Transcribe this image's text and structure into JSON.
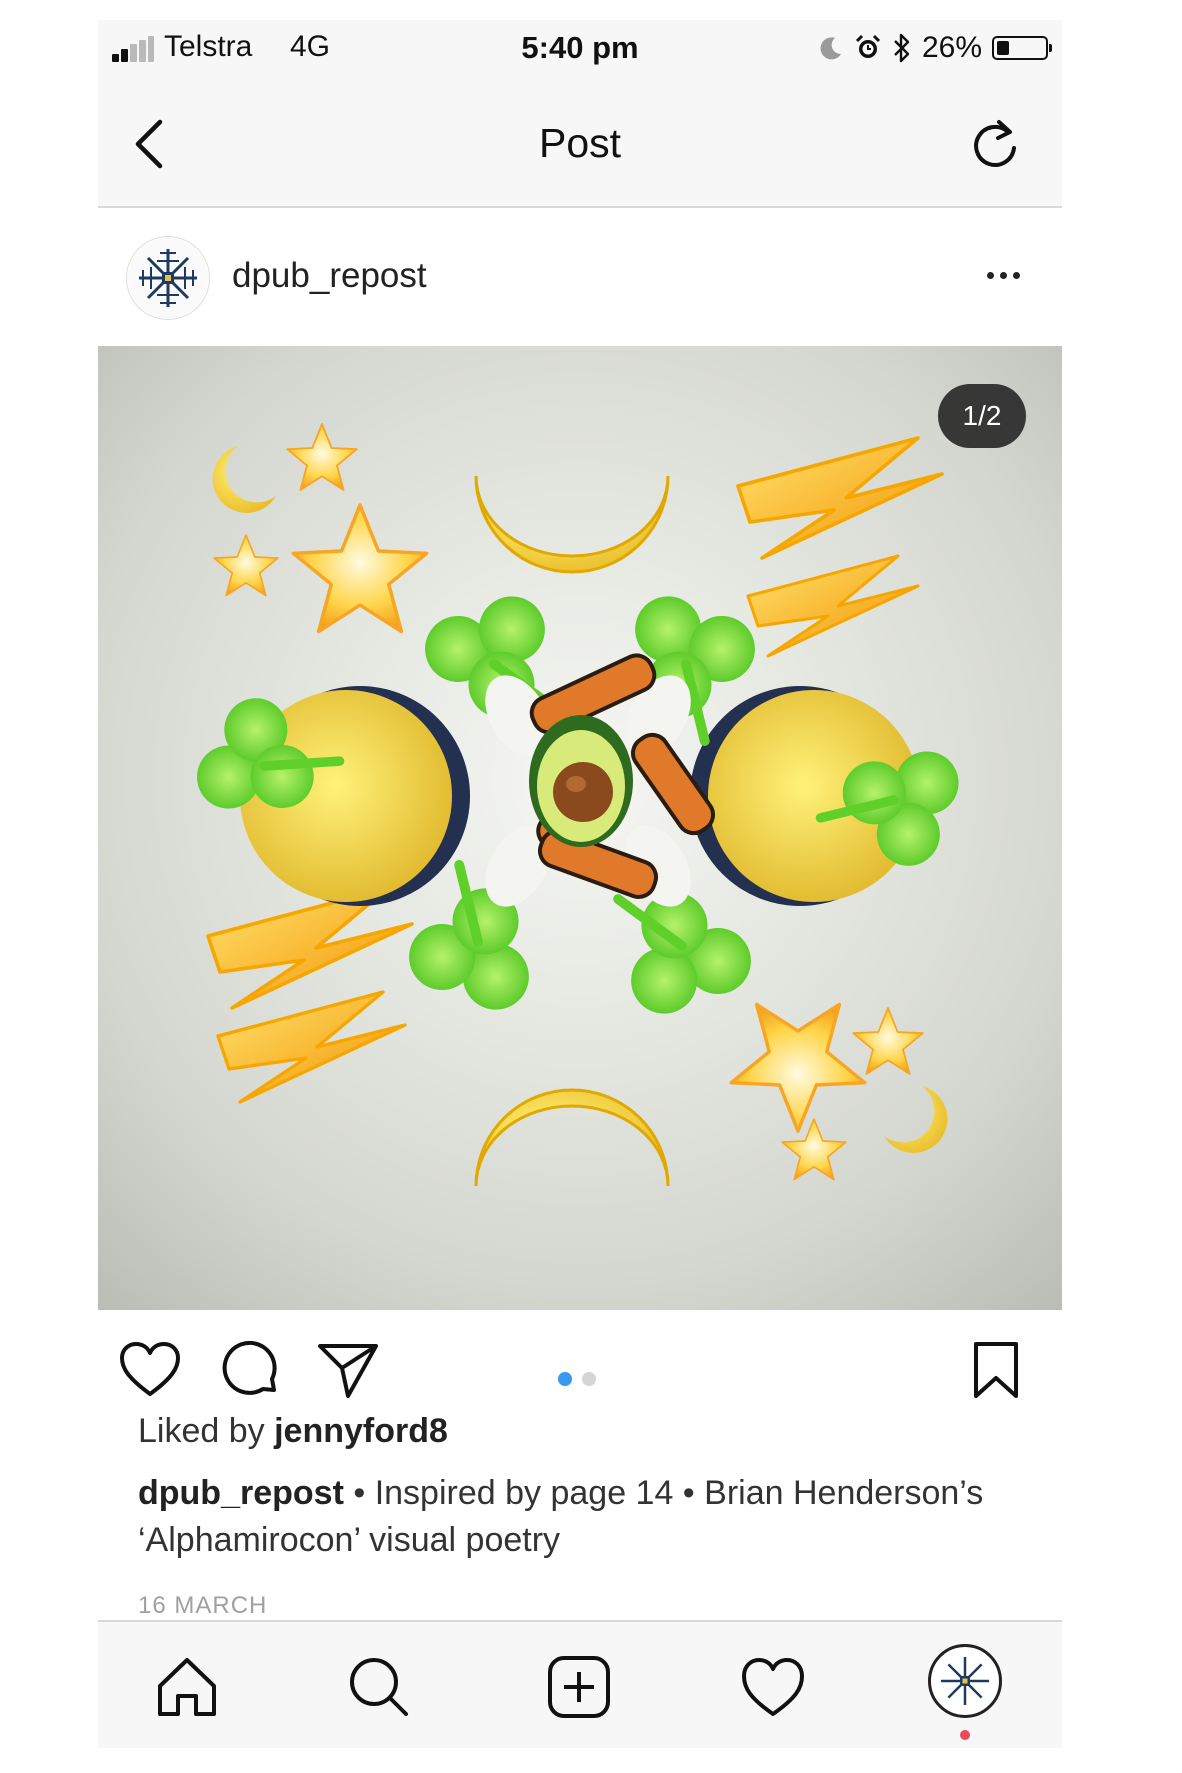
{
  "status_bar": {
    "carrier": "Telstra",
    "network": "4G",
    "time": "5:40 pm",
    "battery": "26%",
    "battery_level": 0.26
  },
  "nav": {
    "title": "Post",
    "back_icon": "chevron-left-icon",
    "refresh_icon": "refresh-icon"
  },
  "post": {
    "username": "dpub_repost",
    "image_counter": "1/2",
    "slide_current": 1,
    "slide_total": 2,
    "liked_by_prefix": "Liked by ",
    "liked_by_user": "jennyford8",
    "caption_user": "dpub_repost",
    "caption_text": " • Inspired by page 14 • Brian Henderson’s ‘Alphamirocon’ visual poetry",
    "date": "16 MARCH"
  },
  "colors": {
    "accent_blue": "#3897f0",
    "notification_red": "#ed4956",
    "bar_background": "#f7f7f7"
  },
  "tabs": [
    "home-icon",
    "search-icon",
    "add-post-icon",
    "activity-heart-icon",
    "profile-avatar"
  ]
}
